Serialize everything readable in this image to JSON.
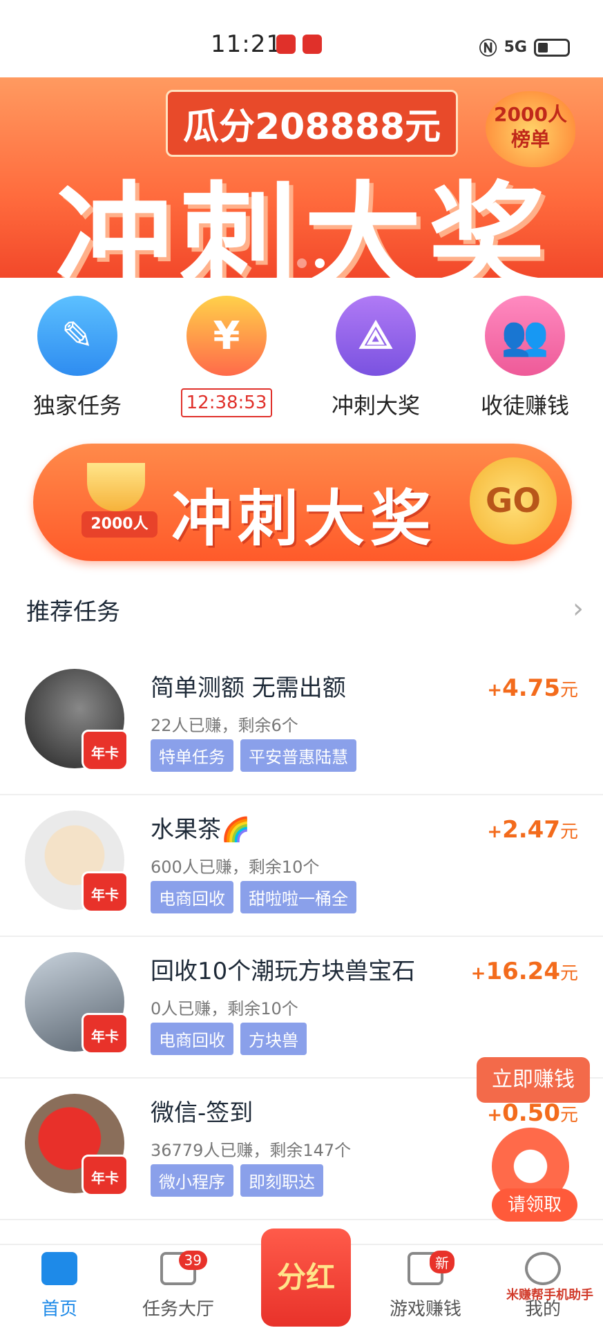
{
  "status": {
    "time": "11:21",
    "network": "5G"
  },
  "banner": {
    "pill": "瓜分208888元",
    "headline": "冲刺大奖",
    "flame_text": "2000人\n榜单"
  },
  "quick": [
    {
      "label": "独家任务",
      "icon": "edit-icon",
      "color": "#3aa6f5"
    },
    {
      "label": "12:38:53",
      "icon": "yuan-icon",
      "color": "#ffb030",
      "is_timer": true
    },
    {
      "label": "冲刺大奖",
      "icon": "hierarchy-icon",
      "color": "#9a6ae8"
    },
    {
      "label": "收徒赚钱",
      "icon": "users-icon",
      "color": "#f06aa8"
    }
  ],
  "cta": {
    "label": "冲刺大奖",
    "go": "GO",
    "trophy_text": "2000人"
  },
  "section": {
    "title": "推荐任务"
  },
  "tasks": [
    {
      "title": "简单测额 无需出额",
      "meta": "22人已赚，剩余6个",
      "tags": [
        "特单任务",
        "平安普惠陆慧"
      ],
      "price": "4.75",
      "unit": "元",
      "crown": "年卡"
    },
    {
      "title": "水果茶🌈",
      "meta": "600人已赚，剩余10个",
      "tags": [
        "电商回收",
        "甜啦啦一桶全"
      ],
      "price": "2.47",
      "unit": "元",
      "crown": "年卡"
    },
    {
      "title": "回收10个潮玩方块兽宝石",
      "meta": "0人已赚，剩余10个",
      "tags": [
        "电商回收",
        "方块兽"
      ],
      "price": "16.24",
      "unit": "元",
      "crown": "年卡"
    },
    {
      "title": "微信-签到",
      "meta": "36779人已赚，剩余147个",
      "tags": [
        "微小程序",
        "即刻职达"
      ],
      "price": "0.50",
      "unit": "元",
      "crown": "年卡"
    }
  ],
  "floating": {
    "earn": "立即赚钱",
    "claim": "请领取"
  },
  "tabs": [
    {
      "label": "首页",
      "active": true
    },
    {
      "label": "任务大厅",
      "badge": "39"
    },
    {
      "label": "分红"
    },
    {
      "label": "游戏赚钱",
      "badge": "新"
    },
    {
      "label": "我的"
    }
  ],
  "watermark": "米赚帮手机助手"
}
